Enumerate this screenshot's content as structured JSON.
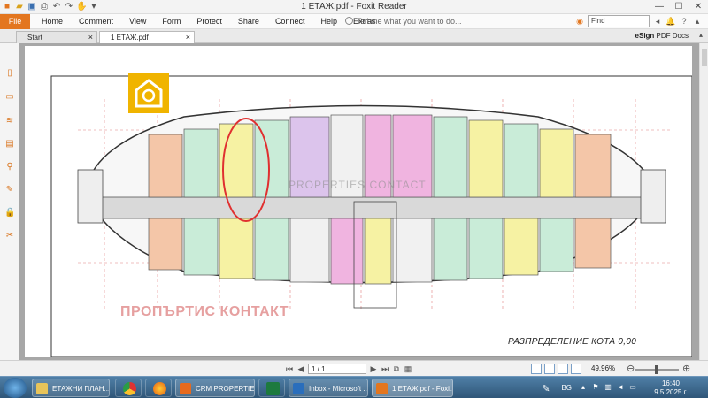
{
  "window": {
    "title": "1 ЕТАЖ.pdf - Foxit Reader",
    "buttons": {
      "minimize": "—",
      "maximize": "☐",
      "close": "✕"
    },
    "quick_access_icons": [
      "app-icon",
      "open-icon",
      "save-icon",
      "print-icon",
      "undo-icon",
      "redo-icon",
      "hand-icon",
      "dropdown-icon"
    ]
  },
  "ribbon": {
    "file_label": "File",
    "tabs": [
      "Home",
      "Comment",
      "View",
      "Form",
      "Protect",
      "Share",
      "Connect",
      "Help",
      "Extras"
    ],
    "tell_me_placeholder": "Tell me what you want to do...",
    "find_placeholder": "Find",
    "right_icons": [
      "search-options-icon",
      "search-prev-icon",
      "notification-icon",
      "help-icon",
      "collapse-ribbon-icon"
    ]
  },
  "doc_tabs": {
    "tabs": [
      {
        "label": "Start"
      },
      {
        "label": "1 ЕТАЖ.pdf"
      }
    ],
    "esign_brand": "eSign",
    "esign_label": "PDF Docs"
  },
  "left_nav_icons": [
    "pages-panel-icon",
    "bookmarks-icon",
    "layers-icon",
    "comments-icon",
    "attachments-icon",
    "signatures-icon",
    "security-icon",
    "tools-icon"
  ],
  "document": {
    "watermark_text": "ПРОПЪРТИС КОНТАКТ",
    "plan_caption": "РАЗПРЕДЕЛЕНИЕ КОТА 0,00",
    "center_watermark": "PROPERTIES CONTACT",
    "logo_color": "#f0b400",
    "highlight_color": "#e03030"
  },
  "status_bar": {
    "page_value": "1 / 1",
    "zoom_value": "49.96%",
    "zoom_level": 0.5
  },
  "taskbar": {
    "items": [
      {
        "label": "ЕТАЖНИ ПЛАН...",
        "icon": "folder-icon"
      },
      {
        "label": "",
        "icon": "chrome-icon"
      },
      {
        "label": "",
        "icon": "firefox-icon"
      },
      {
        "label": "CRM PROPERTIES...",
        "icon": "crm-icon"
      },
      {
        "label": "",
        "icon": "excel-icon"
      },
      {
        "label": "Inbox - Microsoft ...",
        "icon": "outlook-icon"
      },
      {
        "label": "1 ЕТАЖ.pdf - Foxi...",
        "icon": "foxit-icon"
      }
    ],
    "language": "BG",
    "time": "16:40",
    "date": "9.5.2025 г."
  }
}
